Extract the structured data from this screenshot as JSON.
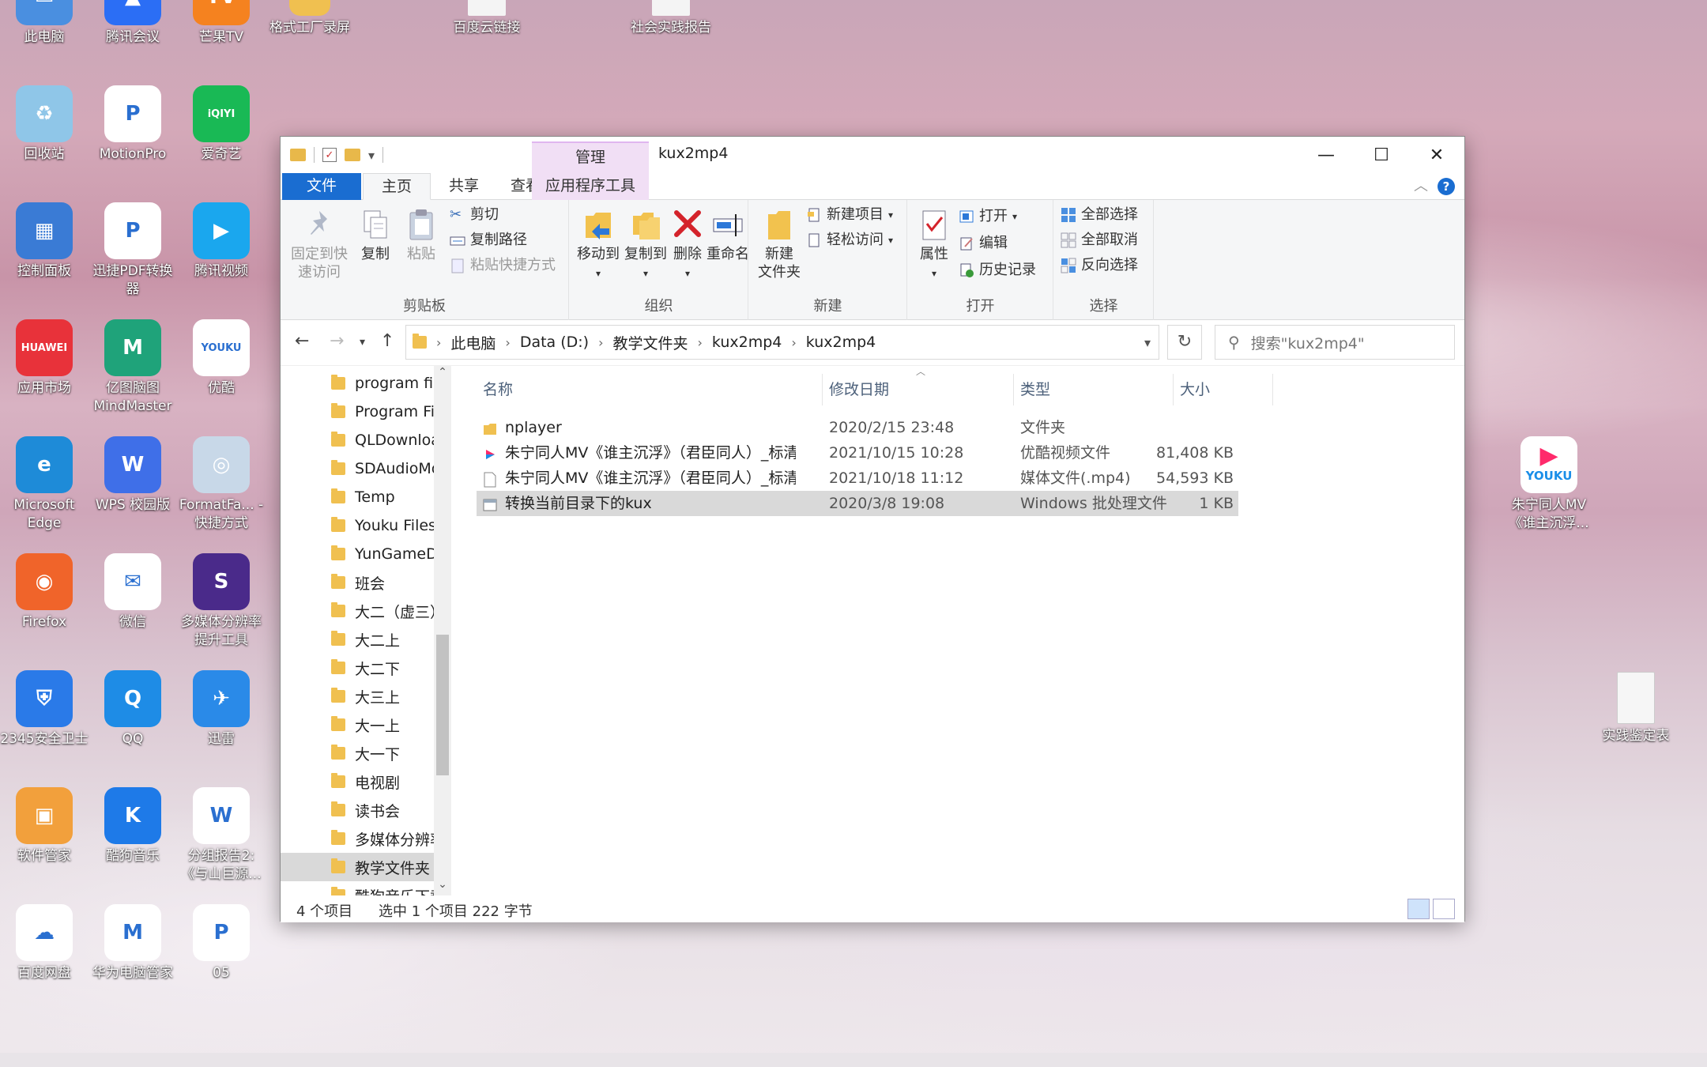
{
  "desktop": {
    "icons_col1": [
      {
        "label": "此电脑",
        "color": "#4a8fe0",
        "glyph": "▭"
      },
      {
        "label": "回收站",
        "color": "#8fc6e8",
        "glyph": "♻"
      },
      {
        "label": "控制面板",
        "color": "#3a7bd5",
        "glyph": "▦"
      },
      {
        "label": "应用市场",
        "color": "#e8323a",
        "glyph": "HUAWEI"
      },
      {
        "label": "Microsoft Edge",
        "color": "#1e8bd8",
        "glyph": "e"
      },
      {
        "label": "Firefox",
        "color": "#f0642a",
        "glyph": "◉"
      },
      {
        "label": "2345安全卫士",
        "color": "#2a7ae8",
        "glyph": "⛨"
      },
      {
        "label": "软件管家",
        "color": "#f2a03c",
        "glyph": "▣"
      },
      {
        "label": "百度网盘",
        "color": "#ffffff",
        "glyph": "☁"
      }
    ],
    "icons_col2": [
      {
        "label": "腾讯会议",
        "color": "#2b6ef5",
        "glyph": "▲"
      },
      {
        "label": "MotionPro",
        "color": "#ffffff",
        "glyph": "P"
      },
      {
        "label": "迅捷PDF转换器",
        "color": "#ffffff",
        "glyph": "P"
      },
      {
        "label": "亿图脑图 MindMaster",
        "color": "#1fa37a",
        "glyph": "M"
      },
      {
        "label": "WPS 校园版",
        "color": "#3f6fe8",
        "glyph": "W"
      },
      {
        "label": "微信",
        "color": "#ffffff",
        "glyph": "✉"
      },
      {
        "label": "QQ",
        "color": "#1e8ce6",
        "glyph": "Q"
      },
      {
        "label": "酷狗音乐",
        "color": "#1e7ae8",
        "glyph": "K"
      },
      {
        "label": "华为电脑管家",
        "color": "#ffffff",
        "glyph": "M"
      }
    ],
    "icons_col3": [
      {
        "label": "芒果TV",
        "color": "#f5821f",
        "glyph": "TV"
      },
      {
        "label": "爱奇艺",
        "color": "#19b955",
        "glyph": "iQIYI"
      },
      {
        "label": "腾讯视频",
        "color": "#1aa7ee",
        "glyph": "▶"
      },
      {
        "label": "优酷",
        "color": "#ffffff",
        "glyph": "YOUKU"
      },
      {
        "label": "FormatFa... - 快捷方式",
        "color": "#c8d8e8",
        "glyph": "◎"
      },
      {
        "label": "多媒体分辨率提升工具",
        "color": "#4a2a8a",
        "glyph": "S"
      },
      {
        "label": "迅雷",
        "color": "#2a8ae8",
        "glyph": "✈"
      },
      {
        "label": "分组报告2: 《与山巨源...",
        "color": "#ffffff",
        "glyph": "W"
      },
      {
        "label": "05",
        "color": "#ffffff",
        "glyph": "P"
      }
    ],
    "top_row": [
      {
        "label": "格式工厂录屏"
      },
      {
        "label": "百度云链接"
      },
      {
        "label": "社会实践报告"
      }
    ],
    "right_icons": [
      {
        "label": "朱宁同人MV 《谁主沉浮...",
        "glyph": "YOUKU"
      },
      {
        "label": "实践鉴定表",
        "glyph": ""
      }
    ]
  },
  "window": {
    "title": "kux2mp4",
    "context_tab_header": "管理",
    "tabs": {
      "file": "文件",
      "home": "主页",
      "share": "共享",
      "view": "查看",
      "app_tools": "应用程序工具"
    },
    "ribbon": {
      "clipboard": {
        "label": "剪贴板",
        "pin": "固定到快速访问",
        "copy": "复制",
        "paste": "粘贴",
        "cut": "剪切",
        "copy_path": "复制路径",
        "paste_shortcut": "粘贴快捷方式"
      },
      "organize": {
        "label": "组织",
        "move_to": "移动到",
        "copy_to": "复制到",
        "delete": "删除",
        "rename": "重命名"
      },
      "new": {
        "label": "新建",
        "new_folder": "新建\n文件夹",
        "new_item": "新建项目",
        "easy_access": "轻松访问"
      },
      "open": {
        "label": "打开",
        "properties": "属性",
        "open": "打开",
        "edit": "编辑",
        "history": "历史记录"
      },
      "select": {
        "label": "选择",
        "select_all": "全部选择",
        "select_none": "全部取消",
        "invert": "反向选择"
      }
    },
    "address": {
      "crumbs": [
        "此电脑",
        "Data (D:)",
        "教学文件夹",
        "kux2mp4",
        "kux2mp4"
      ],
      "search_placeholder": "搜索\"kux2mp4\""
    },
    "nav_pane": [
      {
        "label": "program file"
      },
      {
        "label": "Program File"
      },
      {
        "label": "QLDownload"
      },
      {
        "label": "SDAudioMo"
      },
      {
        "label": "Temp"
      },
      {
        "label": "Youku Files"
      },
      {
        "label": "YunGameDo"
      },
      {
        "label": "班会"
      },
      {
        "label": "大二（虚三）"
      },
      {
        "label": "大二上"
      },
      {
        "label": "大二下"
      },
      {
        "label": "大三上"
      },
      {
        "label": "大一上"
      },
      {
        "label": "大一下"
      },
      {
        "label": "电视剧"
      },
      {
        "label": "读书会"
      },
      {
        "label": "多媒体分辨率"
      },
      {
        "label": "教学文件夹"
      },
      {
        "label": "酷狗音乐下载"
      }
    ],
    "columns": {
      "name": "名称",
      "date": "修改日期",
      "type": "类型",
      "size": "大小"
    },
    "files": [
      {
        "name": "nplayer",
        "date": "2020/2/15 23:48",
        "type": "文件夹",
        "size": "",
        "icon": "folder"
      },
      {
        "name": "朱宁同人MV《谁主沉浮》（君臣同人）_标清",
        "date": "2021/10/15 10:28",
        "type": "优酷视频文件",
        "size": "81,408 KB",
        "icon": "youku"
      },
      {
        "name": "朱宁同人MV《谁主沉浮》（君臣同人）_标清",
        "date": "2021/10/18 11:12",
        "type": "媒体文件(.mp4)",
        "size": "54,593 KB",
        "icon": "blank"
      },
      {
        "name": "转换当前目录下的kux",
        "date": "2020/3/8 19:08",
        "type": "Windows 批处理文件",
        "size": "1 KB",
        "icon": "bat"
      }
    ],
    "status": {
      "count": "4 个项目",
      "selection": "选中 1 个项目  222 字节"
    }
  },
  "accent": "#1a6dd1"
}
